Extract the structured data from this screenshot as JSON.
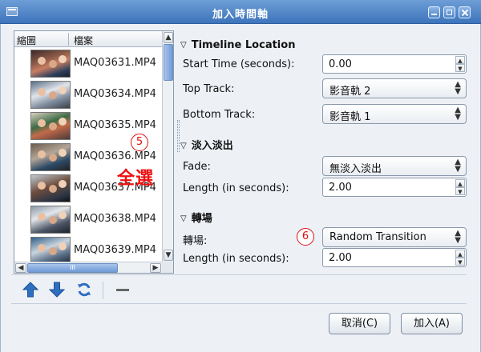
{
  "window": {
    "title": "加入時間軸"
  },
  "file_list": {
    "columns": [
      "縮圖",
      "檔案"
    ],
    "files": [
      "MAQ03631.MP4",
      "MAQ03634.MP4",
      "MAQ03635.MP4",
      "MAQ03636.MP4",
      "MAQ03637.MP4",
      "MAQ03638.MP4",
      "MAQ03639.MP4"
    ],
    "hscroll_grip": "III"
  },
  "annotations": {
    "badge_5": "5",
    "select_all": "全選",
    "badge_6": "6"
  },
  "timeline_location": {
    "title": "Timeline Location",
    "start_time_label": "Start Time (seconds):",
    "start_time_value": "0.00",
    "top_track_label": "Top Track:",
    "top_track_value": "影音軌 2",
    "bottom_track_label": "Bottom Track:",
    "bottom_track_value": "影音軌 1"
  },
  "fade": {
    "title": "淡入淡出",
    "fade_label": "Fade:",
    "fade_value": "無淡入淡出",
    "length_label": "Length (in seconds):",
    "length_value": "2.00"
  },
  "transition": {
    "title": "轉場",
    "transition_label": "轉場:",
    "transition_value": "Random Transition",
    "length_label": "Length (in seconds):",
    "length_value": "2.00"
  },
  "buttons": {
    "cancel": "取消(C)",
    "add": "加入(A)"
  },
  "colors": {
    "titlebar": "#3d74bb",
    "annotation_red": "#dd1111",
    "toolbar_blue": "#2f6fc0"
  }
}
